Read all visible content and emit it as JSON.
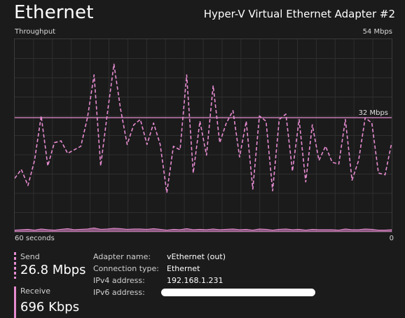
{
  "header": {
    "title": "Ethernet",
    "adapter_name": "Hyper-V Virtual Ethernet Adapter #2"
  },
  "chart": {
    "label_top_left": "Throughput",
    "label_top_right": "54 Mbps",
    "label_bottom_left": "60 seconds",
    "label_bottom_right": "0",
    "reference_label": "32 Mbps"
  },
  "colors": {
    "accent": "#e68bd0",
    "background": "#1b1b1b",
    "grid": "#2f2f2f"
  },
  "stats": {
    "send": {
      "label": "Send",
      "value": "26.8 Mbps"
    },
    "receive": {
      "label": "Receive",
      "value": "696 Kbps"
    }
  },
  "details": {
    "adapter_name_key": "Adapter name:",
    "adapter_name_val": "vEthernet (out)",
    "connection_type_key": "Connection type:",
    "connection_type_val": "Ethernet",
    "ipv4_key": "IPv4 address:",
    "ipv4_val": "192.168.1.231",
    "ipv6_key": "IPv6 address:"
  },
  "chart_data": {
    "type": "line",
    "ylim": [
      0,
      54
    ],
    "xlim": [
      60,
      0
    ],
    "reference_line": 32,
    "series": [
      {
        "values": [
          15,
          17.5,
          13,
          20,
          32.5,
          18.5,
          25,
          25.5,
          22,
          23,
          24,
          32,
          44,
          18.5,
          33,
          47,
          34.5,
          24.5,
          30,
          31.5,
          24.5,
          30.5,
          24.5,
          11,
          24,
          23,
          44,
          16.5,
          31,
          21.5,
          41,
          25,
          30.5,
          34,
          21,
          31,
          12,
          32.5,
          31,
          11.5,
          31.5,
          33,
          17,
          31.5,
          14,
          30,
          20,
          24,
          19.5,
          19,
          31.5,
          14.5,
          20,
          32,
          30.5,
          16.5,
          16,
          25
        ]
      },
      {
        "values": [
          0.5,
          0.6,
          0.7,
          0.5,
          0.8,
          0.6,
          0.5,
          0.7,
          0.9,
          0.6,
          0.7,
          0.8,
          1.1,
          0.7,
          0.8,
          1.0,
          0.9,
          0.7,
          0.8,
          0.8,
          0.7,
          0.9,
          0.7,
          0.5,
          0.7,
          0.6,
          0.9,
          0.6,
          0.7,
          0.6,
          0.8,
          0.6,
          0.7,
          0.8,
          0.6,
          0.7,
          0.5,
          0.8,
          0.7,
          0.5,
          0.7,
          0.8,
          0.6,
          0.7,
          0.5,
          0.7,
          0.6,
          0.6,
          0.6,
          0.5,
          0.8,
          0.6,
          0.6,
          0.8,
          0.7,
          0.5,
          0.5,
          0.6
        ]
      }
    ]
  }
}
